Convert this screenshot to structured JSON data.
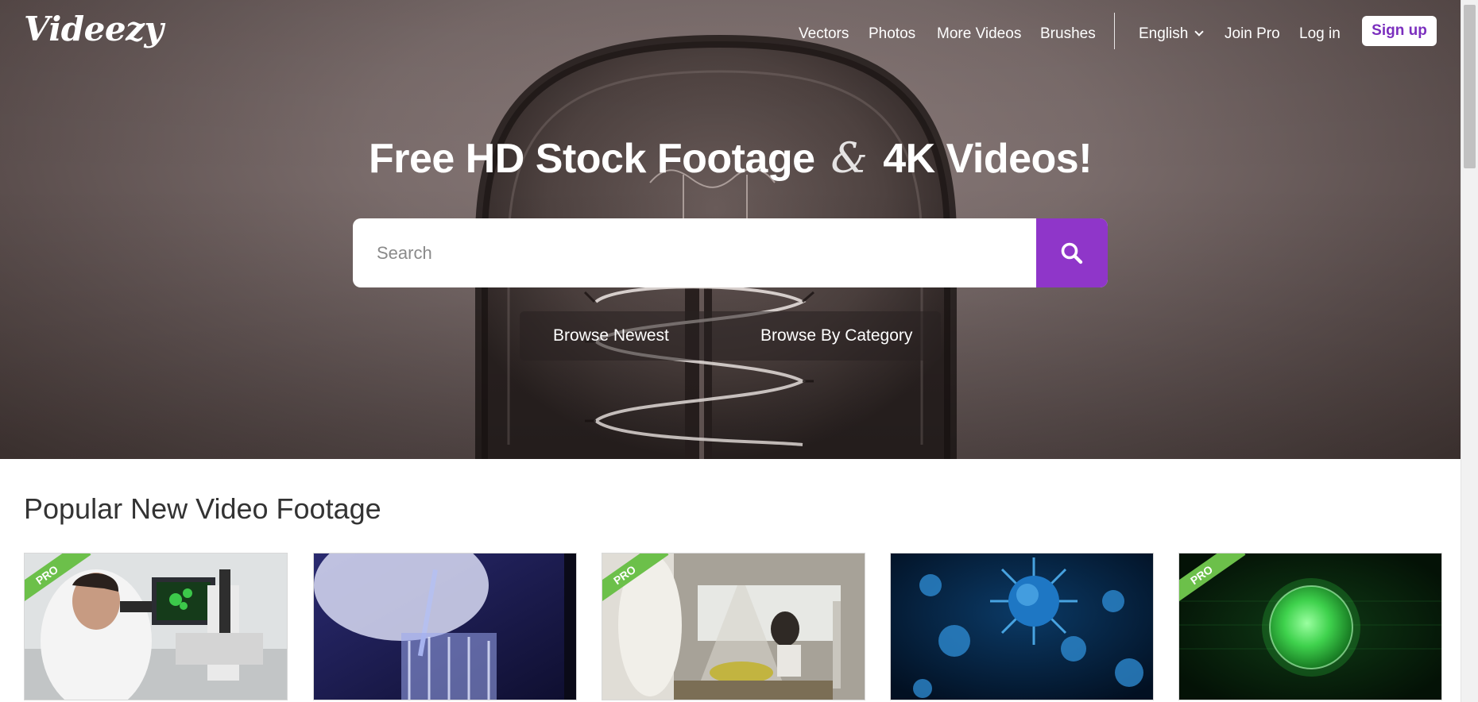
{
  "header": {
    "logo": "Videezy",
    "nav": [
      "Vectors",
      "Photos",
      "More Videos",
      "Brushes"
    ],
    "language": "English",
    "join_pro": "Join Pro",
    "login": "Log in",
    "signup": "Sign up"
  },
  "hero": {
    "title_part1": "Free HD Stock Footage",
    "title_amp": "&",
    "title_part2": "4K Videos!",
    "search_placeholder": "Search",
    "browse_newest": "Browse Newest",
    "browse_category": "Browse By Category"
  },
  "section": {
    "title": "Popular New Video Footage"
  },
  "thumbnails": [
    {
      "badge": "PRO",
      "subject": "scientist-microscope"
    },
    {
      "badge": "",
      "subject": "lab-pipette"
    },
    {
      "badge": "PRO",
      "subject": "lab-flask"
    },
    {
      "badge": "",
      "subject": "virus-blue"
    },
    {
      "badge": "PRO",
      "subject": "green-cell"
    }
  ],
  "colors": {
    "accent": "#8f36c9",
    "signup_text": "#7b2fbe",
    "pro_badge": "#6cc04a"
  }
}
